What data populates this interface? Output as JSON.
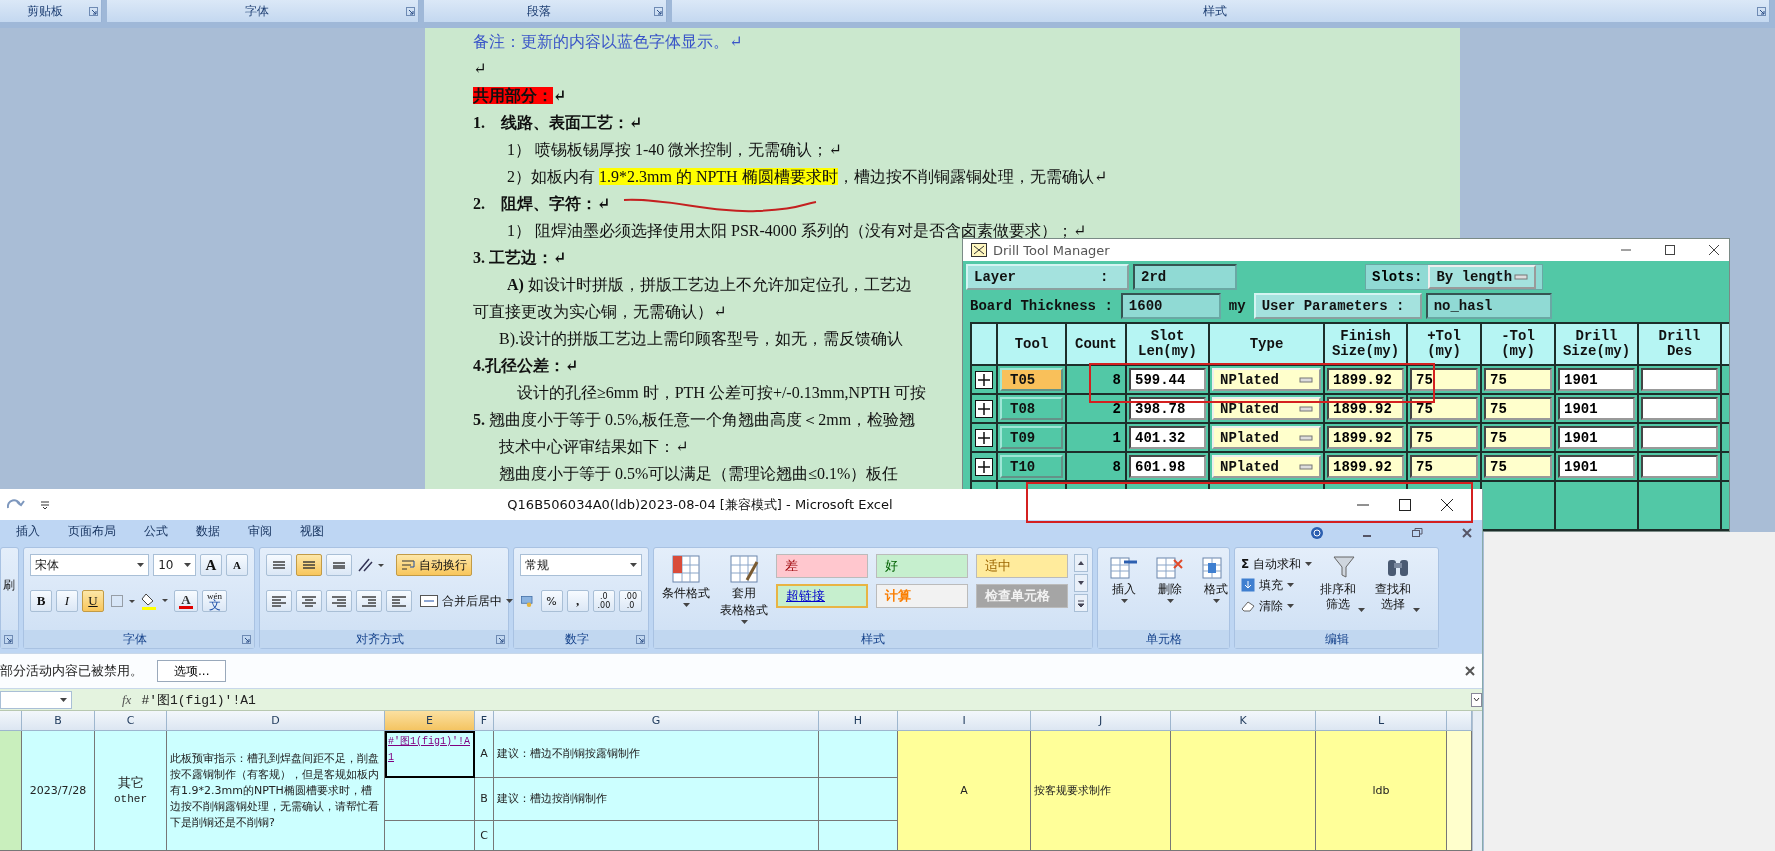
{
  "word_ribbon": {
    "groups": [
      {
        "label": "剪贴板"
      },
      {
        "label": "字体"
      },
      {
        "label": "段落"
      },
      {
        "label": "样式"
      }
    ]
  },
  "document": {
    "paragraphs": [
      {
        "kind": "note",
        "text": "备注：更新的内容以蓝色字体显示。↵"
      },
      {
        "kind": "body",
        "text": "↵"
      },
      {
        "kind": "heading",
        "segments": [
          {
            "text": "共用部分：",
            "color": "#ff0000"
          },
          {
            "text": "↵"
          }
        ]
      },
      {
        "kind": "heading",
        "text": "1.    线路、表面工艺：↵"
      },
      {
        "kind": "item",
        "text": "1） 喷锡板锡厚按 1-40 微米控制，无需确认；↵"
      },
      {
        "kind": "item",
        "segments": [
          {
            "text": "2）如板内有 "
          },
          {
            "text": "1.9*2.3mm 的 NPTH 椭圆槽要求时",
            "color": "#ffff00"
          },
          {
            "text": "，槽边按不削铜露铜处理，无需确认↵"
          }
        ]
      },
      {
        "kind": "heading",
        "text": "2.    阻焊、字符：↵"
      },
      {
        "kind": "item",
        "text": "1） 阻焊油墨必须选择使用太阳 PSR-4000 系列的（没有对是否含卤素做要求）；↵"
      },
      {
        "kind": "heading",
        "text": "3. 工艺边：↵"
      },
      {
        "kind": "item",
        "text": "**A)** 如设计时拼版，拼版工艺边上不允许加定位孔，工艺边"
      },
      {
        "kind": "body",
        "text": "可直接更改为实心铜，无需确认）↵"
      },
      {
        "kind": "indented",
        "text": "B).设计的拼版工艺边上需印顾客型号，如无，需反馈确认"
      },
      {
        "kind": "heading",
        "text": "4.孔径公差：↵"
      },
      {
        "kind": "deep",
        "text": "设计的孔径≥6mm 时，PTH 公差可按+/-0.13mm,NPTH 可按"
      },
      {
        "kind": "body",
        "text": "**5.** 翘曲度小于等于 0.5%,板任意一个角翘曲高度＜2mm，检验翘"
      },
      {
        "kind": "indented",
        "text": "技术中心评审结果如下：↵"
      },
      {
        "kind": "indented",
        "text": "翘曲度小于等于 0.5%可以满足（需理论翘曲≤0.1%）板任"
      }
    ]
  },
  "drill_tool_manager": {
    "title": "Drill Tool Manager",
    "layer_label": "Layer          :",
    "layer": "2rd",
    "slots_label": "Slots:",
    "slots": "By length",
    "thickness_label": "Board Thickness :",
    "thickness": "1600",
    "thickness_unit": "my",
    "user_params_label": "User Parameters :",
    "user_params": "no_hasl",
    "columns": [
      [
        "Tool"
      ],
      [
        "Count"
      ],
      [
        "Slot",
        "Len(my)"
      ],
      [
        "Type"
      ],
      [
        "Finish",
        "Size(my)"
      ],
      [
        "+Tol",
        "(my)"
      ],
      [
        "-Tol",
        "(my)"
      ],
      [
        "Drill",
        "Size(my)"
      ],
      [
        "Drill",
        "Des"
      ]
    ],
    "rows": [
      {
        "tool": "T05",
        "selected": true,
        "count": "8",
        "slot_len": "599.44",
        "type": "NPlated",
        "finish": "1899.92",
        "plus_tol": "75",
        "minus_tol": "75",
        "drill_size": "1901"
      },
      {
        "tool": "T08",
        "selected": false,
        "count": "2",
        "slot_len": "398.78",
        "type": "NPlated",
        "finish": "1899.92",
        "plus_tol": "75",
        "minus_tol": "75",
        "drill_size": "1901"
      },
      {
        "tool": "T09",
        "selected": false,
        "count": "1",
        "slot_len": "401.32",
        "type": "NPlated",
        "finish": "1899.92",
        "plus_tol": "75",
        "minus_tol": "75",
        "drill_size": "1901"
      },
      {
        "tool": "T10",
        "selected": false,
        "count": "8",
        "slot_len": "601.98",
        "type": "NPlated",
        "finish": "1899.92",
        "plus_tol": "75",
        "minus_tol": "75",
        "drill_size": "1901"
      }
    ]
  },
  "excel": {
    "title": "Q16B506034A0(ldb)2023-08-04  [兼容模式] - Microsoft Excel",
    "tabs": [
      {
        "label": "插入",
        "selected": false
      },
      {
        "label": "页面布局",
        "selected": false
      },
      {
        "label": "公式",
        "selected": false
      },
      {
        "label": "数据",
        "selected": false
      },
      {
        "label": "审阅",
        "selected": false
      },
      {
        "label": "视图",
        "selected": false
      }
    ],
    "clipboard": {
      "painter": "刷"
    },
    "font": {
      "label": "字体",
      "name": "宋体",
      "size": "10",
      "grow": "A",
      "shrink": "A",
      "styles": [
        {
          "label": "B",
          "kind": "bold",
          "on": false
        },
        {
          "label": "I",
          "kind": "italic",
          "on": false
        },
        {
          "label": "U",
          "kind": "underline",
          "on": true
        }
      ],
      "font_color": "A",
      "phonetic_top": "wén",
      "phonetic": "文"
    },
    "alignment": {
      "label": "对齐方式",
      "vertical": [
        {
          "kind": "top",
          "on": false
        },
        {
          "kind": "middle",
          "on": true
        },
        {
          "kind": "bottom",
          "on": false
        }
      ],
      "wrap": {
        "label": "自动换行",
        "on": true
      },
      "merge": "合并后居中"
    },
    "number": {
      "label": "数字",
      "format": "常规",
      "percent": "%",
      "comma": ",",
      "decimals": [
        [
          ".0",
          ".00"
        ],
        [
          ".00",
          ".0"
        ]
      ]
    },
    "styles": {
      "label": "样式",
      "buttons": [
        [
          "条件格式"
        ],
        [
          "套用",
          "表格格式"
        ]
      ],
      "cell_styles": [
        {
          "label": "差",
          "kind": "bad",
          "color": "#ffc7ce",
          "selected": false
        },
        {
          "label": "好",
          "kind": "good",
          "color": "#c6efce",
          "selected": false
        },
        {
          "label": "适中",
          "kind": "neutral",
          "color": "#ffeb9c",
          "selected": false
        },
        {
          "label": "超链接",
          "kind": "hyperlink",
          "color": "#c6efce",
          "selected": true
        },
        {
          "label": "计算",
          "kind": "calculation",
          "color": "#f2f2f2",
          "selected": false
        },
        {
          "label": "检查单元格",
          "kind": "check",
          "color": "#a5a5a5",
          "selected": false
        }
      ]
    },
    "cells": {
      "label": "单元格",
      "buttons": [
        "插入",
        "删除",
        "格式"
      ]
    },
    "editing": {
      "label": "编辑",
      "sum_symbol": "Σ",
      "commands": [
        "自动求和",
        "填充",
        "清除"
      ],
      "buttons": [
        [
          "排序和",
          "筛选"
        ],
        [
          "查找和",
          "选择"
        ]
      ]
    },
    "message_bar": {
      "text": "部分活动内容已被禁用。",
      "button": "选项..."
    },
    "formula_bar": {
      "function_label": "fx",
      "formula": "#'图1(fig1)'!A1"
    },
    "columns": [
      {
        "label": "B",
        "selected": false
      },
      {
        "label": "C",
        "selected": false
      },
      {
        "label": "D",
        "selected": false
      },
      {
        "label": "E",
        "selected": true
      },
      {
        "label": "F",
        "selected": false
      },
      {
        "label": "G",
        "selected": false
      },
      {
        "label": "H",
        "selected": false
      },
      {
        "label": "I",
        "selected": false
      },
      {
        "label": "J",
        "selected": false
      },
      {
        "label": "K",
        "selected": false
      },
      {
        "label": "L",
        "selected": false
      }
    ],
    "row": {
      "date": "2023/7/28",
      "category": [
        "其它",
        "other"
      ],
      "instruction": "此板预审指示：槽孔到焊盘间距不足，削盘按不露铜制作（有客规），但是客规如板内有1.9*2.3mm的NPTH椭圆槽要求时，槽边按不削铜露铜处理，无需确认，请帮忙看下是削铜还是不削铜?",
      "link": "#'图1(fig1)'!A1",
      "options": [
        {
          "letter": "A",
          "text": "建议：槽边不削铜按露铜制作"
        },
        {
          "letter": "B",
          "text": "建议：槽边按削铜制作"
        },
        {
          "letter": "C"
        }
      ],
      "choice": "A",
      "decision": "按客规要求制作",
      "owner": "ldb"
    }
  }
}
